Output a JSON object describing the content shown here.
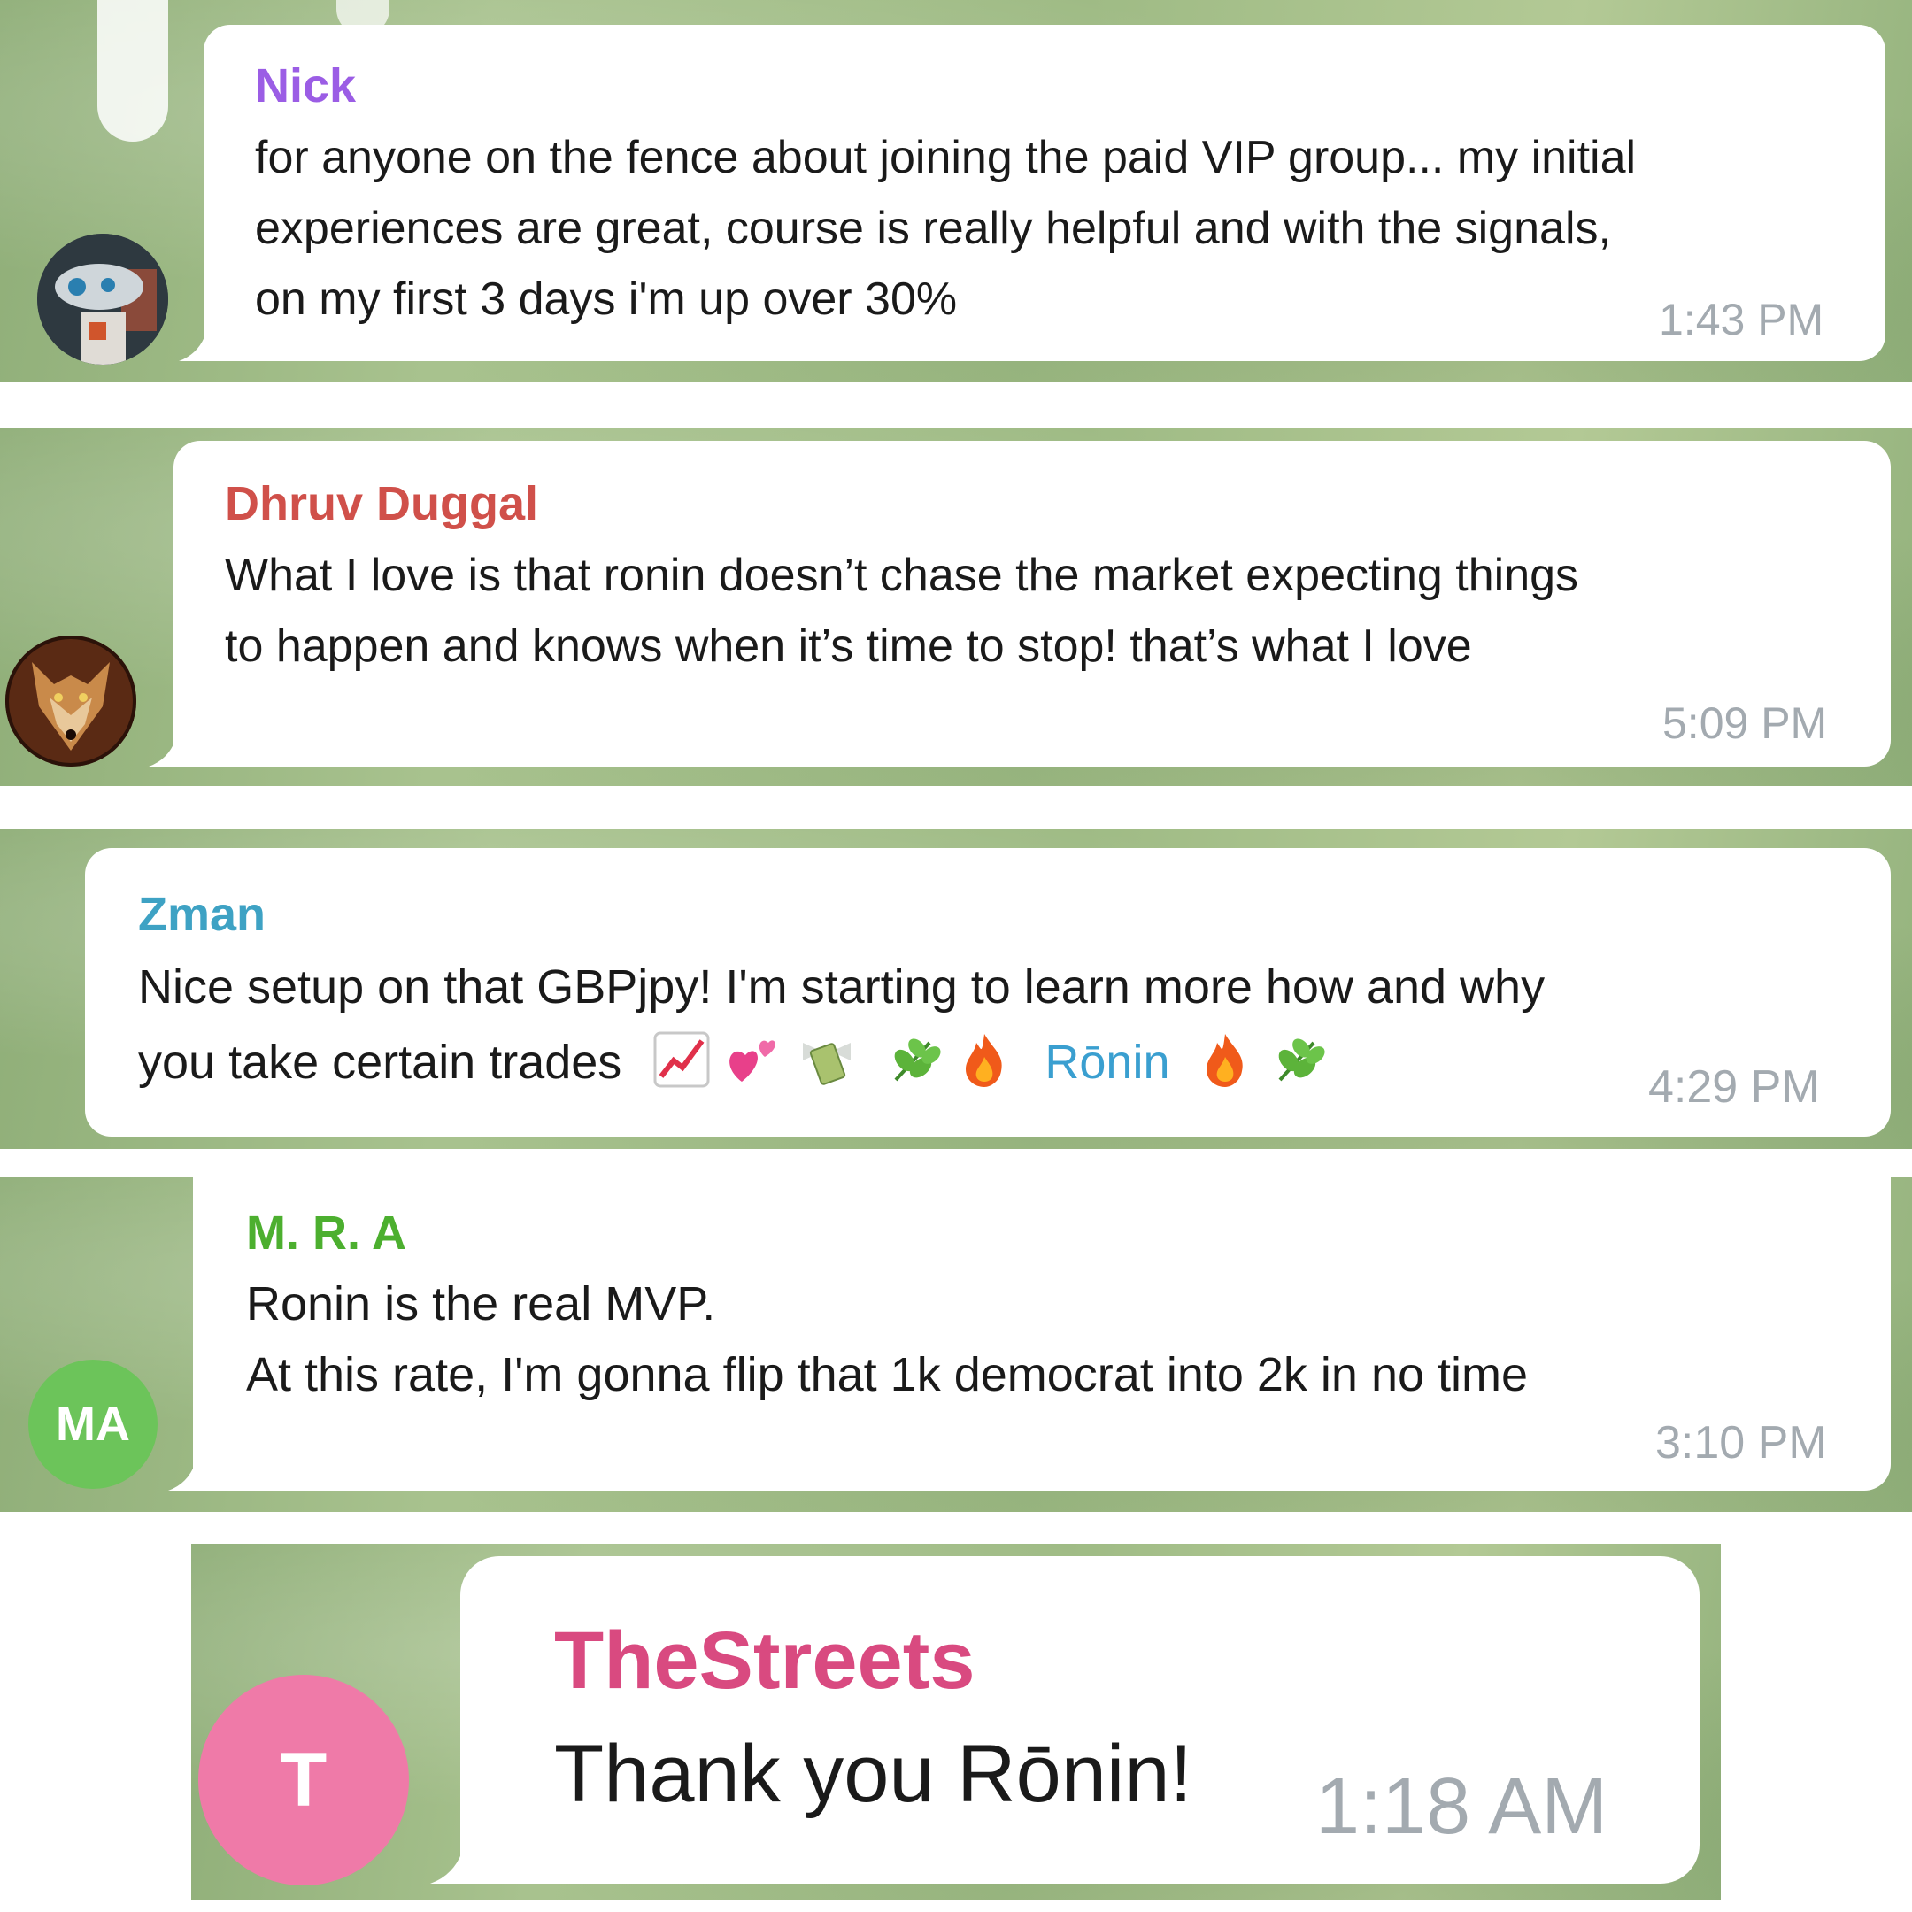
{
  "messages": [
    {
      "sender": "Nick",
      "sender_color": "#9b5de5",
      "lines": [
        "for anyone on the fence about joining the paid VIP group... my initial",
        "experiences are great, course is really helpful and with the signals,",
        "on my first 3 days i'm up over 30%"
      ],
      "time": "1:43 PM",
      "avatar_icon": "robot-photo-avatar"
    },
    {
      "sender": "Dhruv Duggal",
      "sender_color": "#d0504a",
      "lines": [
        "What I love is that ronin doesn’t chase the market expecting things",
        "to happen and knows when it’s time to stop! that’s what I love"
      ],
      "time": "5:09 PM",
      "avatar_icon": "wolf-photo-avatar"
    },
    {
      "sender": "Zman",
      "sender_color": "#3ea2c4",
      "line1": "Nice setup on that GBPjpy! I'm starting to learn more how and why",
      "line2_text": "you take certain trades",
      "emojis_before": [
        "chart-increasing-emoji",
        "two-hearts-emoji",
        "money-with-wings-emoji",
        "herb-emoji",
        "fire-emoji"
      ],
      "mention": "Rōnin",
      "emojis_after": [
        "fire-emoji",
        "herb-emoji"
      ],
      "time": "4:29 PM"
    },
    {
      "sender": "M. R. A",
      "sender_color": "#4caf2f",
      "lines": [
        "Ronin is the real MVP.",
        "At this rate, I'm gonna flip that 1k democrat into 2k in no time"
      ],
      "time": "3:10 PM",
      "avatar_initials": "MA",
      "avatar_color": "#6cc45a"
    },
    {
      "sender": "TheStreets",
      "sender_color": "#d94a80",
      "text": "Thank you Rōnin!",
      "time": "1:18 AM",
      "avatar_initials": "T",
      "avatar_color": "#ef7aa8"
    }
  ]
}
